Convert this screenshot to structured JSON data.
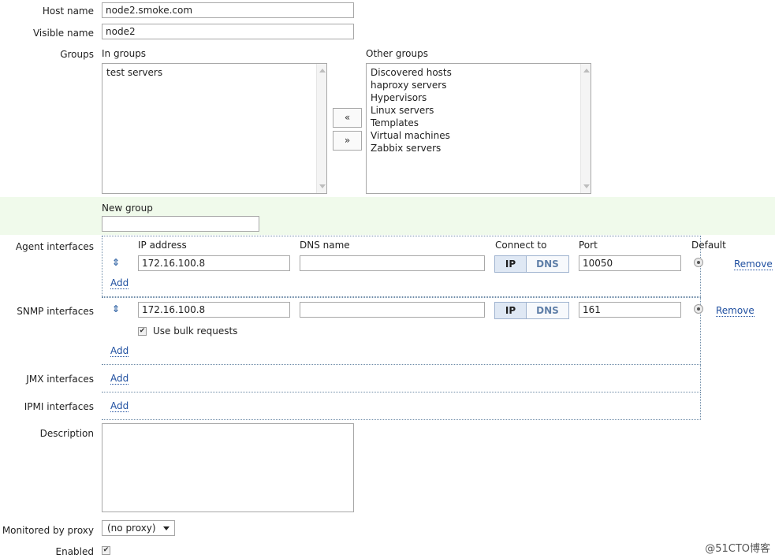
{
  "host": {
    "host_name_label": "Host name",
    "host_name_value": "node2.smoke.com",
    "visible_name_label": "Visible name",
    "visible_name_value": "node2"
  },
  "groups": {
    "label": "Groups",
    "in_groups_label": "In groups",
    "in_groups": [
      "test servers"
    ],
    "other_groups_label": "Other groups",
    "other_groups": [
      "Discovered hosts",
      "haproxy servers",
      "Hypervisors",
      "Linux servers",
      "Templates",
      "Virtual machines",
      "Zabbix servers"
    ],
    "move_left": "«",
    "move_right": "»",
    "new_group_label": "New group",
    "new_group_value": ""
  },
  "interfaces": {
    "agent_label": "Agent interfaces",
    "col_ip": "IP address",
    "col_dns": "DNS name",
    "col_connect": "Connect to",
    "col_port": "Port",
    "col_default": "Default",
    "agent": {
      "ip": "172.16.100.8",
      "dns": "",
      "port": "10050"
    },
    "snmp_label": "SNMP interfaces",
    "snmp": {
      "ip": "172.16.100.8",
      "dns": "",
      "port": "161"
    },
    "use_bulk_label": "Use bulk requests",
    "jmx_label": "JMX interfaces",
    "ipmi_label": "IPMI interfaces",
    "btn_ip": "IP",
    "btn_dns": "DNS",
    "remove": "Remove",
    "add": "Add"
  },
  "description": {
    "label": "Description",
    "value": ""
  },
  "proxy": {
    "label": "Monitored by proxy",
    "value": "(no proxy)"
  },
  "enabled": {
    "label": "Enabled",
    "checked": true
  },
  "watermark": "@51CTO博客",
  "icons": {
    "drag": "drag-handle-icon",
    "check": "checkmark-icon",
    "caret": "chevron-down-icon"
  },
  "colors": {
    "new_group_band": "#f0faeb",
    "link": "#1f4fa0",
    "ip_active": "#dfe8f4"
  }
}
